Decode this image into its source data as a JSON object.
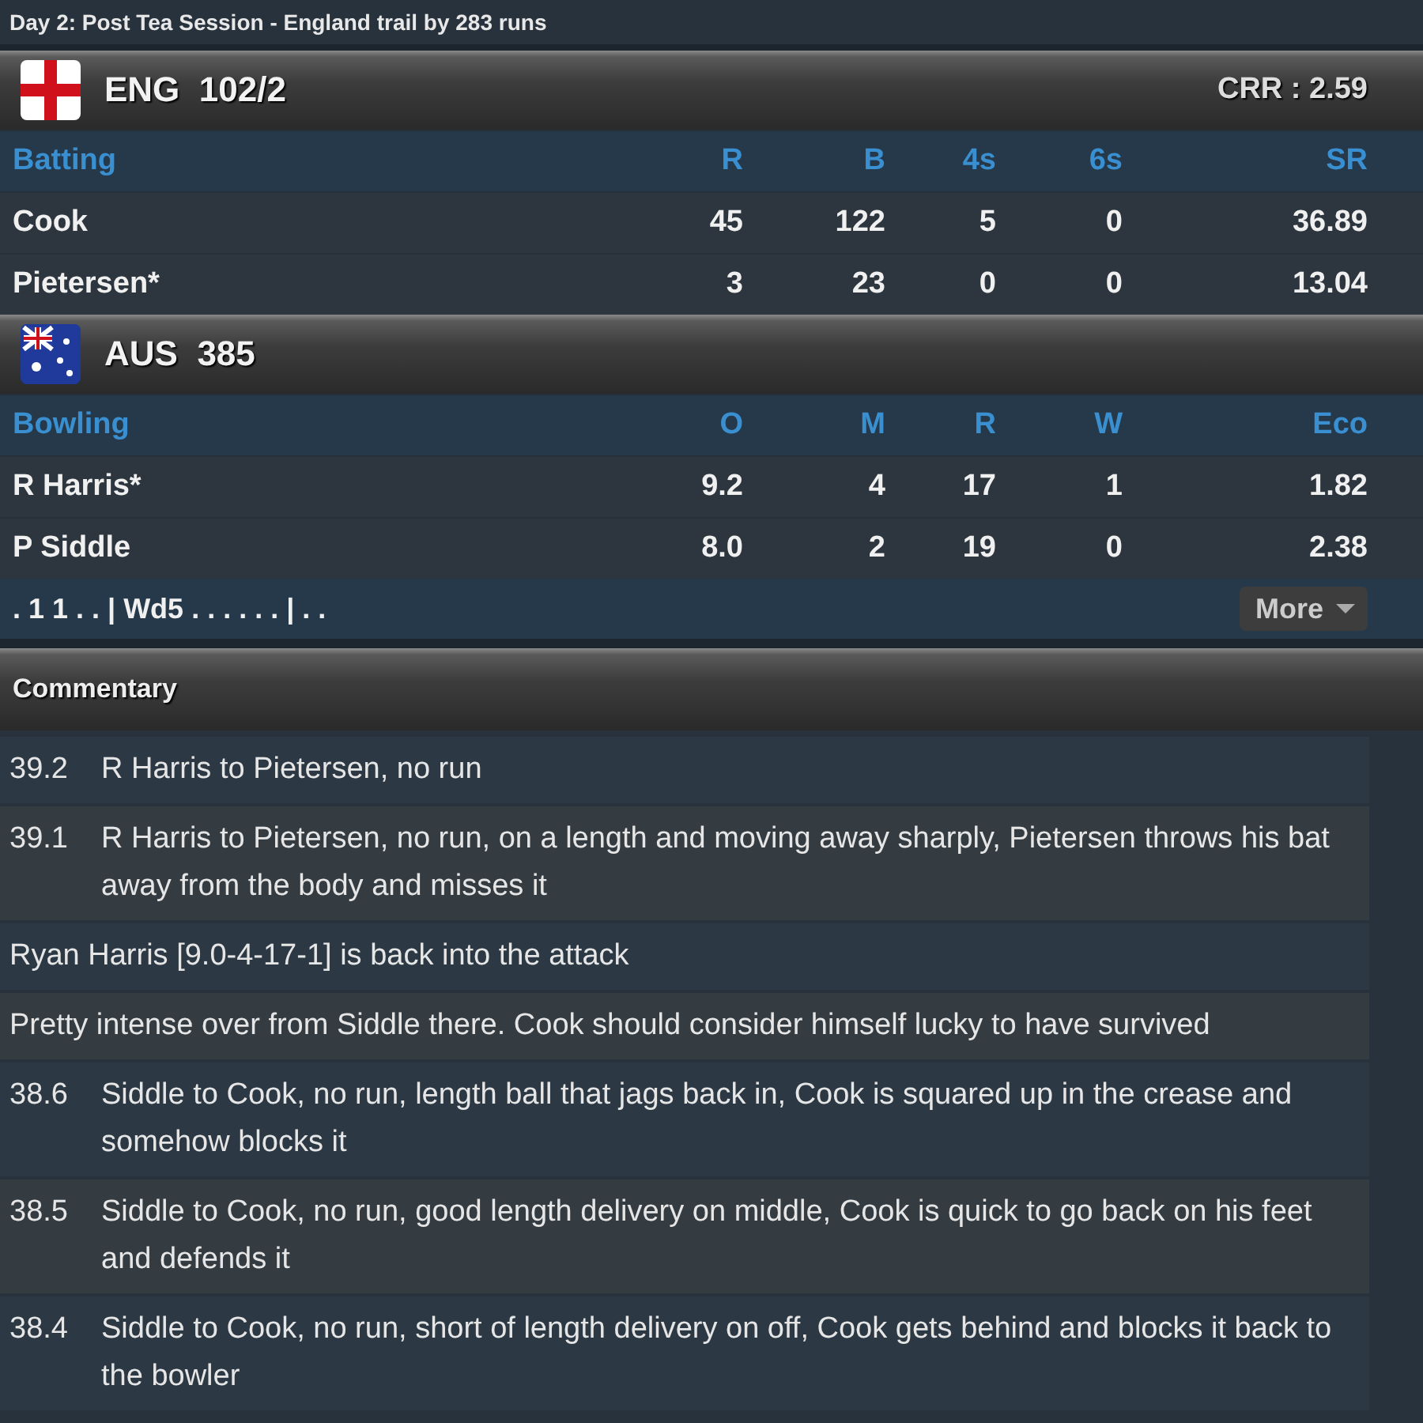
{
  "status": "Day 2: Post Tea Session - England trail by 283 runs",
  "batting_team": {
    "kind": "england",
    "name": "ENG",
    "score": "102/2",
    "crr": "CRR : 2.59"
  },
  "batting": {
    "columns": [
      "Batting",
      "R",
      "B",
      "4s",
      "6s",
      "SR"
    ],
    "rows": [
      [
        "Cook",
        "45",
        "122",
        "5",
        "0",
        "36.89"
      ],
      [
        "Pietersen*",
        "3",
        "23",
        "0",
        "0",
        "13.04"
      ]
    ]
  },
  "bowling_team": {
    "kind": "australia",
    "name": "AUS",
    "score": "385"
  },
  "bowling": {
    "columns": [
      "Bowling",
      "O",
      "M",
      "R",
      "W",
      "Eco"
    ],
    "rows": [
      [
        "R Harris*",
        "9.2",
        "4",
        "17",
        "1",
        "1.82"
      ],
      [
        "P Siddle",
        "8.0",
        "2",
        "19",
        "0",
        "2.38"
      ]
    ]
  },
  "over_summary": ". 1 1 . . | Wd5 . . . . . . | . .",
  "more_button": "More",
  "commentary": {
    "title": "Commentary",
    "entries": [
      {
        "kind": "ball",
        "over": "39.2",
        "text": "R Harris to Pietersen, no run"
      },
      {
        "kind": "ball",
        "over": "39.1",
        "text": "R Harris to Pietersen, no run, on a length and moving away sharply, Pietersen throws his bat away from the body and misses it"
      },
      {
        "kind": "note",
        "text": "Ryan Harris [9.0-4-17-1] is back into the attack"
      },
      {
        "kind": "note",
        "text": "Pretty intense over from Siddle there. Cook should consider himself lucky to have survived"
      },
      {
        "kind": "ball",
        "over": "38.6",
        "text": "Siddle to Cook, no run, length ball that jags back in, Cook is squared up in the crease and somehow blocks it"
      },
      {
        "kind": "ball",
        "over": "38.5",
        "text": "Siddle to Cook, no run, good length delivery on middle, Cook is quick to go back on his feet and defends it"
      },
      {
        "kind": "ball",
        "over": "38.4",
        "text": "Siddle to Cook, no run, short of length delivery on off, Cook gets behind and blocks it back to the bowler"
      }
    ]
  }
}
